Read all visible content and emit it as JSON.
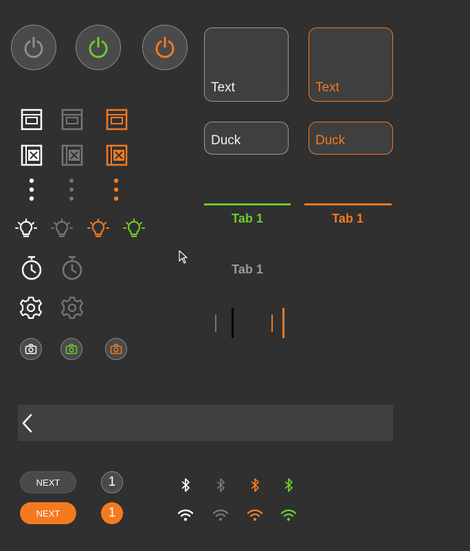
{
  "colors": {
    "background": "#303030",
    "white": "#ffffff",
    "gray": "#858585",
    "orange": "#f47a20",
    "green": "#6ecc2a",
    "surface": "#3f3f3f",
    "toolbar": "#404040"
  },
  "power_buttons": [
    {
      "name": "power-icon-default",
      "color": "gray"
    },
    {
      "name": "power-icon-green",
      "color": "green"
    },
    {
      "name": "power-icon-orange",
      "color": "orange"
    }
  ],
  "cards": {
    "large_default_label": "Text",
    "large_active_label": "Text",
    "small_default_label": "Duck",
    "small_active_label": "Duck"
  },
  "tabs": {
    "green_tab_label": "Tab 1",
    "orange_tab_label": "Tab 1",
    "inactive_tab_label": "Tab 1"
  },
  "icon_sets": [
    "oven-icon",
    "recipe-book-icon",
    "more-vertical-icon",
    "light-bulb-icon",
    "timer-icon",
    "settings-icon",
    "camera-icon",
    "bluetooth-icon",
    "wifi-icon"
  ],
  "bottom": {
    "next_default_label": "NEXT",
    "next_active_label": "NEXT",
    "badge_default_value": "1",
    "badge_active_value": "1"
  }
}
